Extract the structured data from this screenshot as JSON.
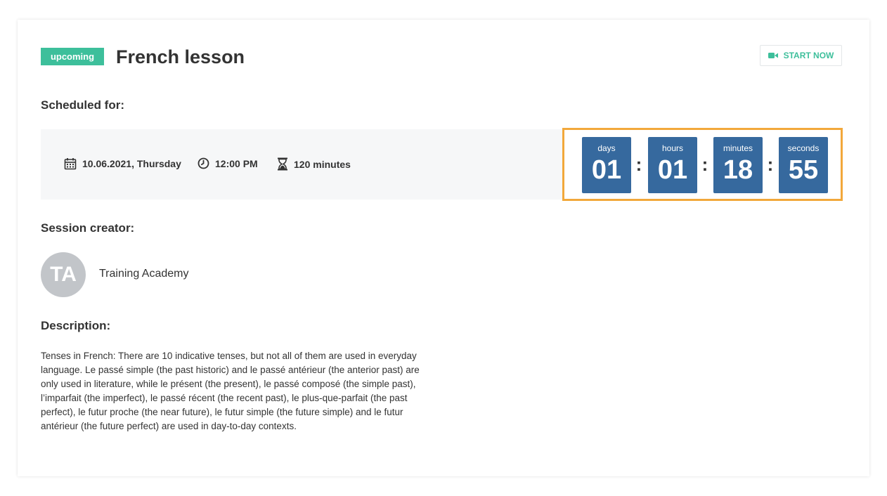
{
  "session": {
    "status": "upcoming",
    "title": "French lesson",
    "start_button": {
      "label": "START NOW",
      "icon": "video-camera-icon"
    }
  },
  "schedule": {
    "heading": "Scheduled for:",
    "date": "10.06.2021, Thursday",
    "date_icon": "calendar-icon",
    "time": "12:00 PM",
    "time_icon": "clock-icon",
    "duration": "120 minutes",
    "duration_icon": "hourglass-icon"
  },
  "countdown": [
    {
      "label": "days",
      "value": "01"
    },
    {
      "label": "hours",
      "value": "01"
    },
    {
      "label": "minutes",
      "value": "18"
    },
    {
      "label": "seconds",
      "value": "55"
    }
  ],
  "countdown_separator": ":",
  "creator": {
    "heading": "Session creator:",
    "initials": "TA",
    "name": "Training Academy"
  },
  "description": {
    "heading": "Description:",
    "text": "Tenses in French: There are 10 indicative tenses, but not all of them are used in everyday language. Le passé simple (the past historic) and le passé antérieur (the anterior past) are only used in literature, while le présent (the present), le passé composé (the simple past), l’imparfait (the imperfect), le passé récent (the recent past), le plus-que-parfait (the past perfect), le futur proche (the near future), le futur simple (the future simple) and le futur antérieur (the future perfect) are used in day-to-day contexts."
  },
  "colors": {
    "accent": "#3dbf9b",
    "countdown_box": "#36699e",
    "countdown_highlight": "#f2a83b",
    "schedule_bg": "#f6f7f8",
    "avatar_bg": "#c2c5c9"
  }
}
